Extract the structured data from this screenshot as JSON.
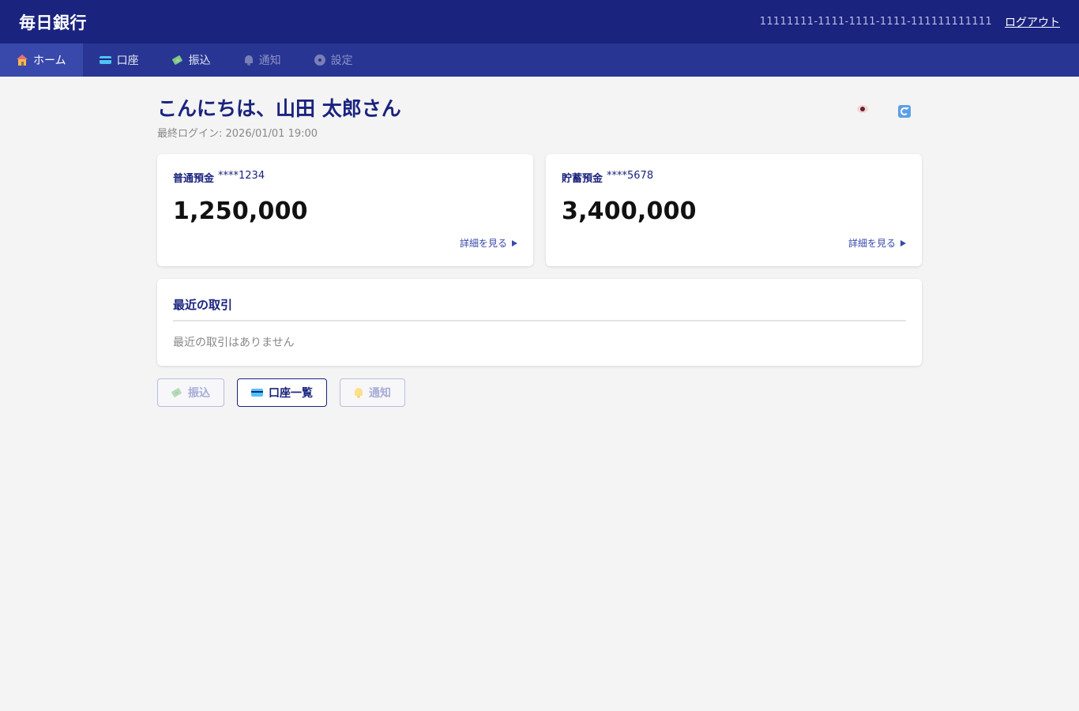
{
  "header": {
    "brand": "毎日銀行",
    "user_id": "11111111-1111-1111-1111-111111111111",
    "logout_label": "ログアウト"
  },
  "nav": {
    "items": [
      {
        "label": "ホーム",
        "icon": "house-icon",
        "state": "active"
      },
      {
        "label": "口座",
        "icon": "card-icon",
        "state": "normal"
      },
      {
        "label": "振込",
        "icon": "money-icon",
        "state": "normal"
      },
      {
        "label": "通知",
        "icon": "bell-icon",
        "state": "disabled"
      },
      {
        "label": "設定",
        "icon": "gear-icon",
        "state": "disabled"
      }
    ]
  },
  "main": {
    "greeting": "こんにちは、山田 太郎さん",
    "last_login": "最終ログイン: 2026/01/01 19:00",
    "header_icons": [
      "eye-icon",
      "refresh-icon"
    ],
    "accounts": [
      {
        "type": "普通預金",
        "number": "****1234",
        "balance": "1,250,000",
        "details_label": "詳細を見る"
      },
      {
        "type": "貯蓄預金",
        "number": "****5678",
        "balance": "3,400,000",
        "details_label": "詳細を見る"
      }
    ],
    "transactions": {
      "title": "最近の取引",
      "empty_text": "最近の取引はありません"
    },
    "actions": [
      {
        "label": "振込",
        "icon": "money-icon",
        "state": "disabled"
      },
      {
        "label": "口座一覧",
        "icon": "card-icon",
        "state": "normal"
      },
      {
        "label": "通知",
        "icon": "bell-icon",
        "state": "disabled"
      }
    ]
  },
  "colors": {
    "header_bg": "#1a237e",
    "nav_bg": "#283593",
    "nav_active_bg": "#3949ab",
    "accent": "#1a237e",
    "page_bg": "#f4f4f4"
  }
}
